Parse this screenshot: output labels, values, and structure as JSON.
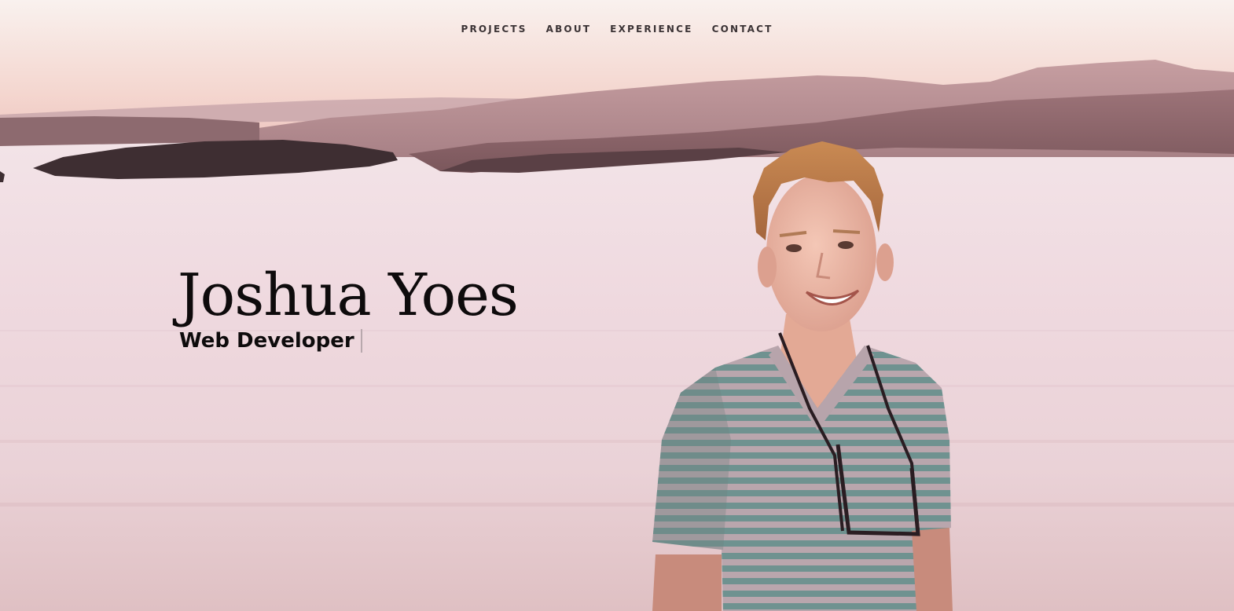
{
  "nav": {
    "items": [
      {
        "label": "PROJECTS"
      },
      {
        "label": "ABOUT"
      },
      {
        "label": "EXPERIENCE"
      },
      {
        "label": "CONTACT"
      }
    ]
  },
  "hero": {
    "name": "Joshua Yoes",
    "role": "Web Developer"
  },
  "colors": {
    "sky_top": "#f7ece8",
    "sky_glow": "#f0c8bf",
    "water": "#f0dce2",
    "island": "#3e2e32",
    "text": "#0e0b0c",
    "nav_text": "#3b3335"
  }
}
